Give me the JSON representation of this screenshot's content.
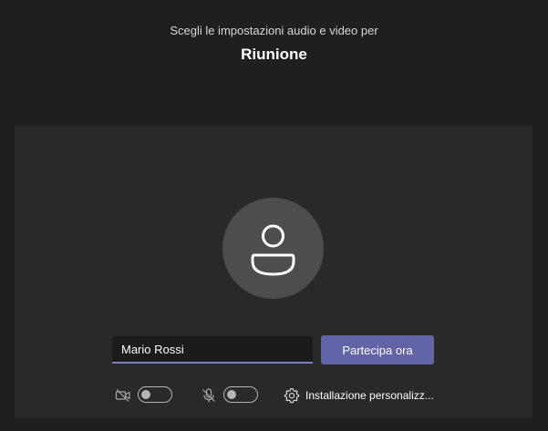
{
  "header": {
    "subtitle": "Scegli le impostazioni audio e video per",
    "title": "Riunione"
  },
  "join_form": {
    "name_value": "Mario Rossi",
    "join_label": "Partecipa ora"
  },
  "controls": {
    "video_toggle_on": false,
    "mic_toggle_on": false,
    "settings_label": "Installazione personalizz..."
  },
  "icons": {
    "avatar": "person-icon",
    "camera": "camera-off-icon",
    "mic": "mic-off-icon",
    "settings": "gear-icon"
  },
  "colors": {
    "background": "#1f1f1f",
    "panel": "#292929",
    "accent": "#6264a7",
    "input_underline": "#7b7fc5"
  }
}
